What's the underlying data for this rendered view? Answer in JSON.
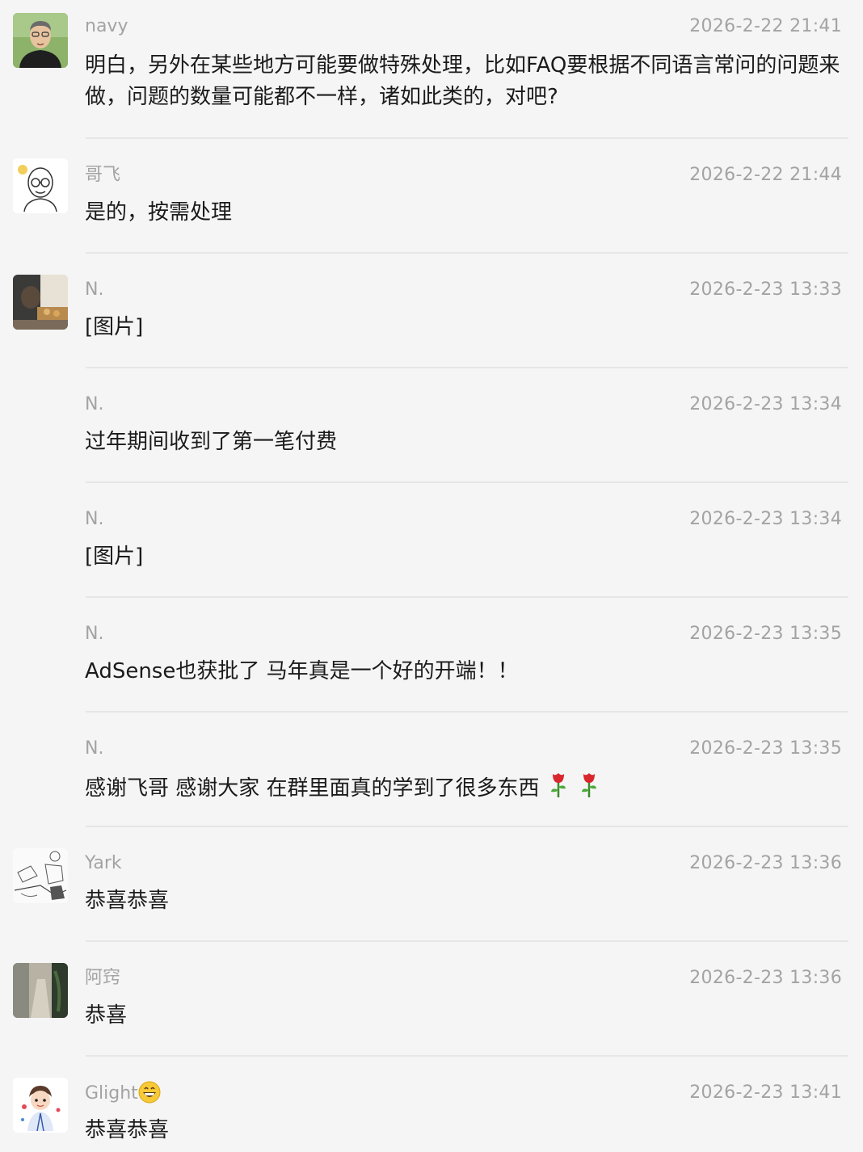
{
  "messages": [
    {
      "sender": "navy",
      "time": "2026-2-22 21:41",
      "text": "明白，另外在某些地方可能要做特殊处理，比如FAQ要根据不同语言常问的问题来做，问题的数量可能都不一样，诸如此类的，对吧?",
      "avatar": "man-avatar-icon"
    },
    {
      "sender": "哥飞",
      "time": "2026-2-22 21:44",
      "text": "是的，按需处理",
      "avatar": "bald-glasses-avatar-icon"
    },
    {
      "sender": "N.",
      "time": "2026-2-23 13:33",
      "text": "[图片]",
      "avatar": "photo-avatar-icon"
    },
    {
      "sender": "N.",
      "time": "2026-2-23 13:34",
      "text": "过年期间收到了第一笔付费"
    },
    {
      "sender": "N.",
      "time": "2026-2-23 13:34",
      "text": "[图片]"
    },
    {
      "sender": "N.",
      "time": "2026-2-23 13:35",
      "text": "AdSense也获批了 马年真是一个好的开端！！"
    },
    {
      "sender": "N.",
      "time": "2026-2-23 13:35",
      "text": "感谢飞哥 感谢大家 在群里面真的学到了很多东西",
      "emojis": [
        "rose-icon",
        "rose-icon"
      ]
    },
    {
      "sender": "Yark",
      "time": "2026-2-23 13:36",
      "text": "恭喜恭喜",
      "avatar": "sketch-avatar-icon"
    },
    {
      "sender": "阿窍",
      "time": "2026-2-23 13:36",
      "text": "恭喜",
      "avatar": "scenery-avatar-icon"
    },
    {
      "sender": "Glight",
      "sender_emoji": "grinning-face-icon",
      "time": "2026-2-23 13:41",
      "text": "恭喜恭喜",
      "avatar": "cartoon-boy-avatar-icon"
    }
  ],
  "colors": {
    "background": "#f5f5f5",
    "meta_text": "#a3a3a3",
    "body_text": "#1b1b1b",
    "divider": "#e6e6e6"
  }
}
